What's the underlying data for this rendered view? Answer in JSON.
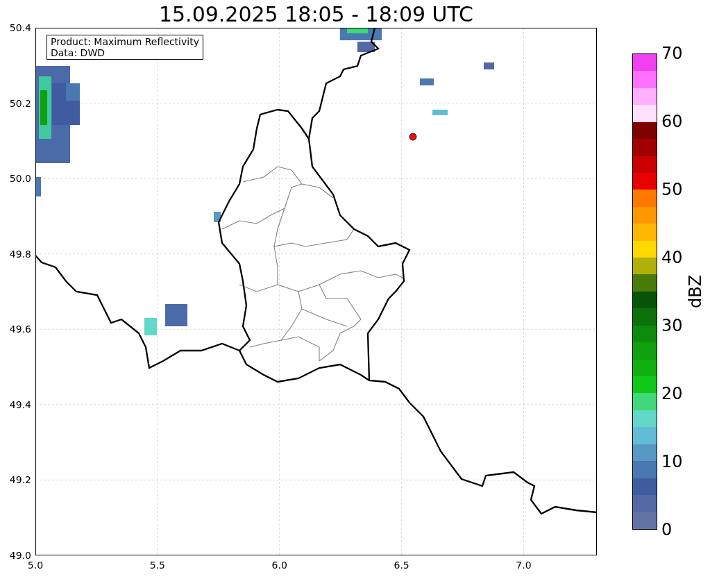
{
  "title": "15.09.2025 18:05 - 18:09 UTC",
  "plot": {
    "annotation_lines": [
      "Product: Maximum Reflectivity",
      "Data: DWD"
    ],
    "x_ticks": [
      "5.0",
      "5.5",
      "6.0",
      "6.5",
      "7.0"
    ],
    "y_ticks": [
      "50.4",
      "50.2",
      "50.0",
      "49.8",
      "49.6",
      "49.4",
      "49.2",
      "49.0"
    ]
  },
  "colorbar": {
    "label": "dBZ",
    "ticks": [
      "70",
      "60",
      "50",
      "40",
      "30",
      "20",
      "10",
      "0"
    ],
    "segments": [
      {
        "color": "#f040f0"
      },
      {
        "color": "#ff70ff"
      },
      {
        "color": "#ffb0ff"
      },
      {
        "color": "#ffe0ff"
      },
      {
        "color": "#800000"
      },
      {
        "color": "#a00000"
      },
      {
        "color": "#c80000"
      },
      {
        "color": "#e80000"
      },
      {
        "color": "#ff7800"
      },
      {
        "color": "#ff9800"
      },
      {
        "color": "#ffb800"
      },
      {
        "color": "#ffd800"
      },
      {
        "color": "#b0b008"
      },
      {
        "color": "#4a7a08"
      },
      {
        "color": "#085408"
      },
      {
        "color": "#0c700c"
      },
      {
        "color": "#0c8c0c"
      },
      {
        "color": "#10a010"
      },
      {
        "color": "#10b010"
      },
      {
        "color": "#10c818"
      },
      {
        "color": "#40d878"
      },
      {
        "color": "#62d8c8"
      },
      {
        "color": "#62bcd6"
      },
      {
        "color": "#5898c4"
      },
      {
        "color": "#4a78b0"
      },
      {
        "color": "#405ca0"
      },
      {
        "color": "#5468a4"
      },
      {
        "color": "#6373a6"
      }
    ]
  }
}
